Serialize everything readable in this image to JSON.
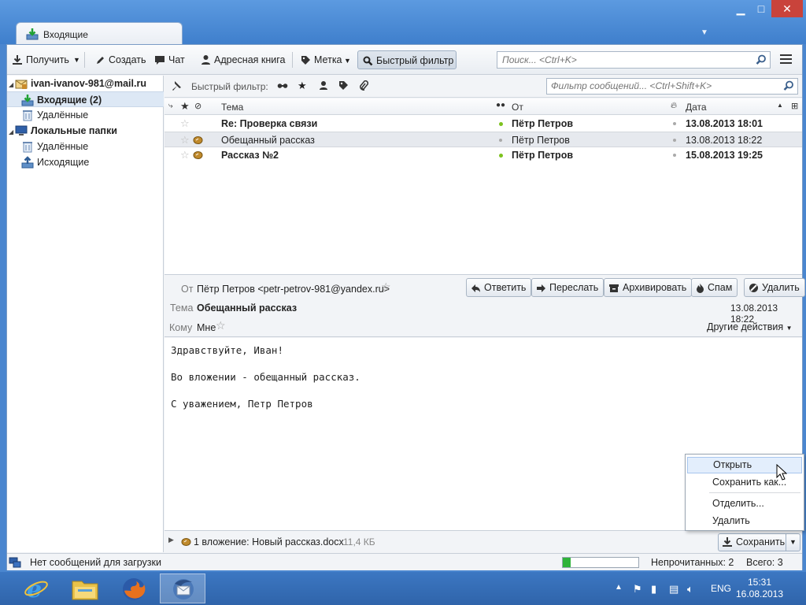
{
  "window": {
    "tab_title": "Входящие"
  },
  "toolbar": {
    "get_label": "Получить",
    "write_label": "Создать",
    "chat_label": "Чат",
    "addressbook_label": "Адресная книга",
    "tag_label": "Метка",
    "quickfilter_label": "Быстрый фильтр",
    "search_placeholder": "Поиск... <Ctrl+K>"
  },
  "folders": {
    "account": "ivan-ivanov-981@mail.ru",
    "inbox": "Входящие (2)",
    "trash": "Удалённые",
    "local_folders": "Локальные папки",
    "local_trash": "Удалённые",
    "outbox": "Исходящие"
  },
  "quick_filter": {
    "label": "Быстрый фильтр:",
    "search_placeholder": "Фильтр сообщений... <Ctrl+Shift+K>"
  },
  "message_list": {
    "columns": {
      "subject": "Тема",
      "from": "От",
      "date": "Дата"
    },
    "rows": [
      {
        "subject": "Re: Проверка связи",
        "from": "Пётр Петров",
        "date": "13.08.2013 18:01",
        "unread": true,
        "attachment": false
      },
      {
        "subject": "Обещанный рассказ",
        "from": "Пётр Петров",
        "date": "13.08.2013 18:22",
        "unread": false,
        "attachment": true
      },
      {
        "subject": "Рассказ №2",
        "from": "Пётр Петров",
        "date": "15.08.2013 19:25",
        "unread": true,
        "attachment": true
      }
    ]
  },
  "message_header": {
    "from_label": "От",
    "from_value": "Пётр Петров <petr-petrov-981@yandex.ru>",
    "subject_label": "Тема",
    "subject_value": "Обещанный рассказ",
    "date_value": "13.08.2013 18:22",
    "to_label": "Кому",
    "to_value": "Мне",
    "other_actions": "Другие действия",
    "buttons": {
      "reply": "Ответить",
      "forward": "Переслать",
      "archive": "Архивировать",
      "spam": "Спам",
      "delete": "Удалить"
    }
  },
  "message_body": {
    "line1": "Здравствуйте, Иван!",
    "line2": "Во вложении - обещанный рассказ.",
    "line3": "С уважением, Петр Петров"
  },
  "attachment_bar": {
    "text": "1 вложение: Новый рассказ.docx",
    "size": "11,4 КБ",
    "save_label": "Сохранить"
  },
  "context_menu": {
    "items": [
      "Открыть",
      "Сохранить как...",
      "Отделить...",
      "Удалить"
    ]
  },
  "status_bar": {
    "message": "Нет сообщений для загрузки",
    "progress": 0.1,
    "unread": "Непрочитанных: 2",
    "total": "Всего: 3"
  },
  "taskbar": {
    "lang": "ENG",
    "time": "15:31",
    "date": "16.08.2013"
  },
  "colors": {
    "accent": "#3f7fcc",
    "progress": "#2fb33a",
    "unread_dot": "#7dc21e"
  }
}
